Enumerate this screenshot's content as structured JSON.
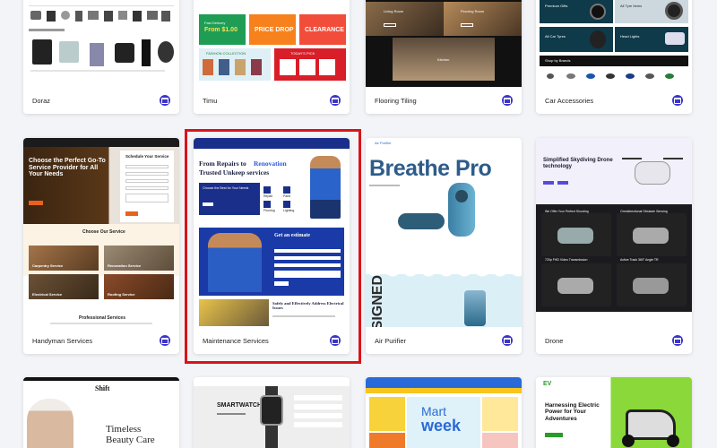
{
  "highlight_color": "#d9131b",
  "badge_color": "#3b35c9",
  "cards": {
    "doraz": {
      "label": "Doraz"
    },
    "timu": {
      "label": "Timu",
      "promo_1": "Fast Delivery",
      "promo_1_price": "From $1.00",
      "promo_2": "PRICE DROP",
      "promo_3": "CLEARANCE",
      "promo_4": "FASHION COLLECTION",
      "promo_5": "TODAY'S PICK"
    },
    "flooring": {
      "label": "Flooring Tiling",
      "room_1": "Living Room",
      "room_2": "Flooring Room",
      "room_3": "Kitchen"
    },
    "car": {
      "label": "Car Accessories",
      "promo_1": "Premium Gifts",
      "promo_2": "All Tyre Items",
      "promo_3": "All Car Tyres",
      "promo_4": "Head Lights",
      "brands_title": "Shop by Brands"
    },
    "handyman": {
      "label": "Handyman Services",
      "hero_title": "Choose the Perfect Go-To Service Provider for All Your Needs",
      "form_title": "Schedule Your Service",
      "section_title": "Choose Our Service",
      "service_1": "Carpentry Service",
      "service_2": "Renovation Service",
      "service_3": "Electrical Service",
      "service_4": "Roofing Service",
      "bottom_title": "Professional Services"
    },
    "maintenance": {
      "label": "Maintenance Services",
      "hero_title_a": "From Repairs to",
      "hero_title_b": "Renovation",
      "hero_title_c": "Trusted Unkeep services",
      "box_title": "Choose the Best for Your Needs",
      "icon_1": "Repair",
      "icon_2": "Paint",
      "icon_3": "Flooring",
      "icon_4": "Lighting",
      "estimate_title": "Get an estimate",
      "bottom_title": "Safely and Effectively Address Electrical Issues"
    },
    "air": {
      "label": "Air Purifier",
      "logo": "Air Purifier",
      "hero_title": "Breathe Pro",
      "side_text": "ESIGNED"
    },
    "drone": {
      "label": "Drone",
      "hero_title": "Simplified Skydiving Drone technology",
      "cell_1": "We Offer Your Perfect Shooting",
      "cell_2": "Omnidirectional Obstacle Sensing",
      "cell_3": "720p FHD Video Transmission",
      "cell_4": "Active Track 360° Angle TR"
    },
    "shift": {
      "logo": "Shift",
      "hero_title_1": "Timeless",
      "hero_title_2": "Beauty Care"
    },
    "smartwatch": {
      "hero_title": "SMARTWATCH"
    },
    "mart": {
      "title_1": "Mart",
      "title_2": "week"
    },
    "ev": {
      "logo": "EV",
      "hero_title": "Harnessing Electric Power for Your Adventures"
    }
  }
}
